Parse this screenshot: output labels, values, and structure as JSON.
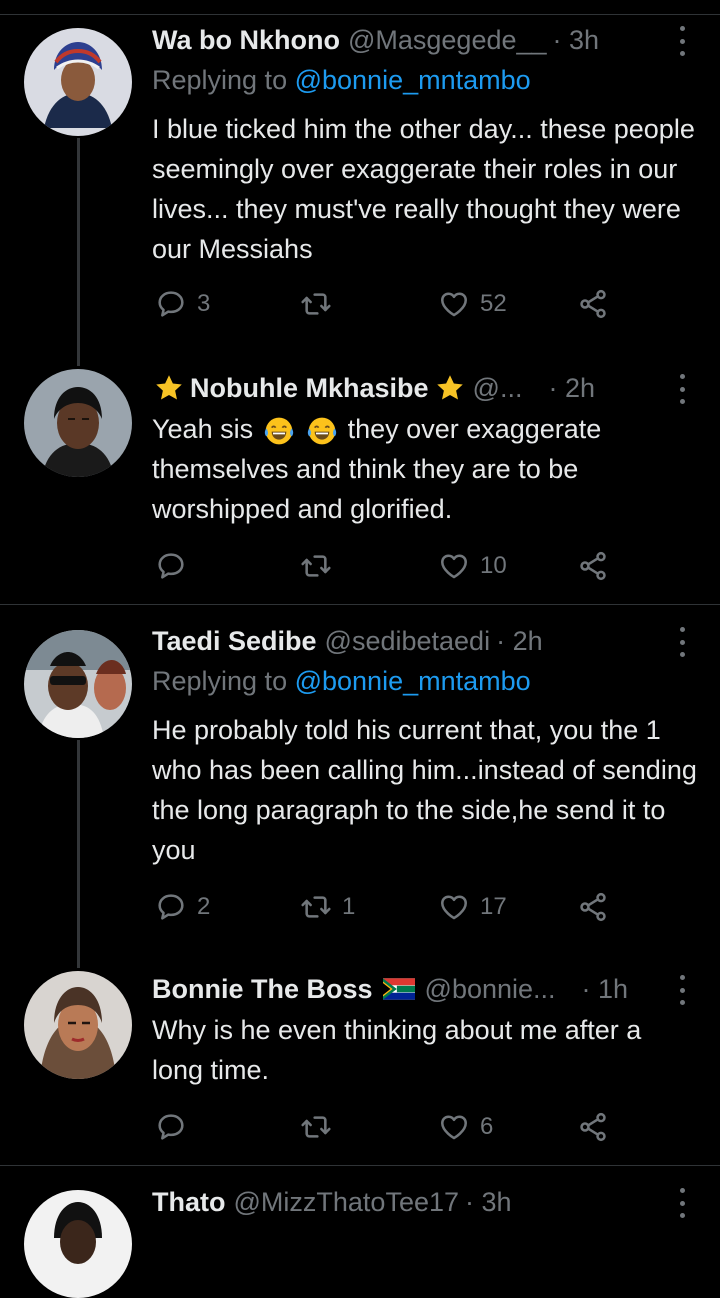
{
  "tweets": [
    {
      "name": "Wa bo Nkhono",
      "handle": "@Masgegede__",
      "time": "· 3h",
      "replying_label": "Replying to ",
      "replying_to": "@bonnie_mntambo",
      "text": "I blue ticked him the other day... these people seemingly over exaggerate their roles in our lives... they must've really thought they were our Messiahs",
      "replies": "3",
      "retweets": "",
      "likes": "52"
    },
    {
      "name": "Nobuhle Mkhasibe",
      "handle": "@...",
      "time": "· 2h",
      "text_before": "Yeah sis",
      "text_after": "they over exaggerate themselves and think they are to be worshipped and glorified.",
      "replies": "",
      "retweets": "",
      "likes": "10"
    },
    {
      "name": "Taedi Sedibe",
      "handle": "@sedibetaedi",
      "time": "· 2h",
      "replying_label": "Replying to ",
      "replying_to": "@bonnie_mntambo",
      "text": "He probably told his current that, you the 1 who has been calling him...instead of sending the long paragraph to the side,he send it to you",
      "replies": "2",
      "retweets": "1",
      "likes": "17"
    },
    {
      "name": "Bonnie The Boss",
      "handle": "@bonnie...",
      "time": "· 1h",
      "text": "Why is he even thinking about me after a long time.",
      "replies": "",
      "retweets": "",
      "likes": "6"
    },
    {
      "name": "Thato",
      "handle": "@MizzThatoTee17",
      "time": "· 3h"
    }
  ],
  "icons": {
    "reply": "reply-icon",
    "retweet": "retweet-icon",
    "like": "heart-icon",
    "share": "share-icon",
    "more": "more-vertical-icon",
    "star": "star-emoji",
    "laugh": "laughing-crying-emoji",
    "flag": "south-africa-flag-emoji"
  },
  "colors": {
    "background": "#000000",
    "text": "#e7e9ea",
    "muted": "#71767b",
    "link": "#1d9bf0",
    "divider": "#2f3336"
  }
}
